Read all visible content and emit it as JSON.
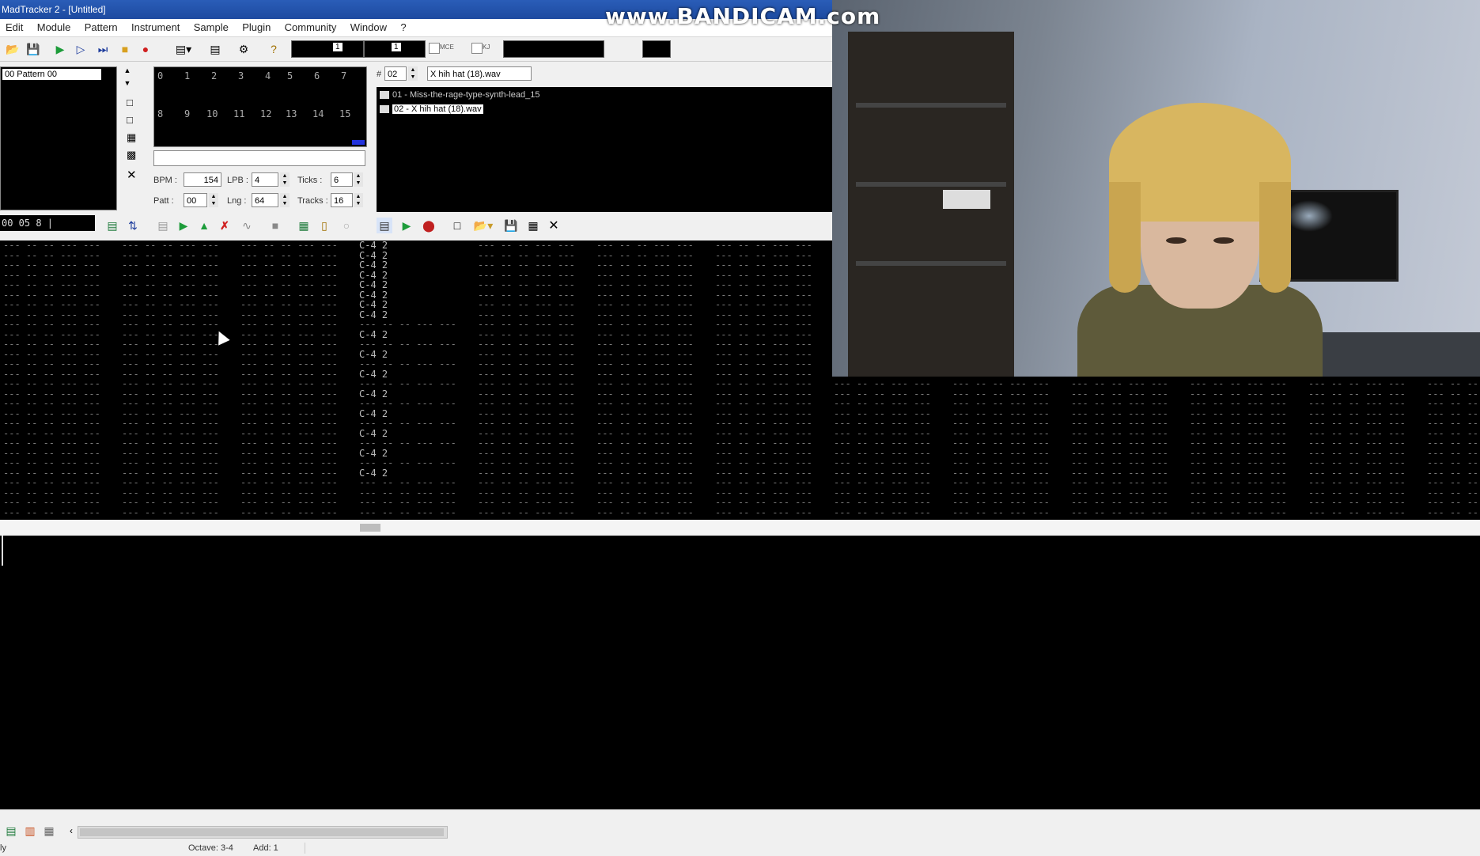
{
  "window": {
    "title": "MadTracker 2 - [Untitled]"
  },
  "watermark": "www.BANDICAM.com",
  "menu": [
    "Edit",
    "Module",
    "Pattern",
    "Instrument",
    "Sample",
    "Plugin",
    "Community",
    "Window",
    "?"
  ],
  "toolbar": {
    "octave_value": "1",
    "step_value": "1",
    "mce_label": "MCE",
    "kj_label": "KJ"
  },
  "pattern_list": {
    "item": "00  Pattern 00"
  },
  "order_grid": {
    "row1": [
      "0",
      "1",
      "2",
      "3",
      "4",
      "5",
      "6",
      "7"
    ],
    "row2": [
      "8",
      "9",
      "10",
      "11",
      "12",
      "13",
      "14",
      "15"
    ]
  },
  "song": {
    "bpm_label": "BPM :",
    "bpm": "154",
    "lpb_label": "LPB :",
    "lpb": "4",
    "ticks_label": "Ticks :",
    "ticks": "6",
    "patt_label": "Patt :",
    "patt": "00",
    "lng_label": "Lng :",
    "lng": "64",
    "tracks_label": "Tracks :",
    "tracks": "16"
  },
  "position_display": "00 05  8 |",
  "sample": {
    "hash": "#",
    "number": "02",
    "name": "X hih hat (18).wav",
    "items": [
      "01 - Miss-the-rage-type-synth-lead_15",
      "02 - X hih hat (18).wav"
    ]
  },
  "pattern": {
    "note": "C-4",
    "instrument": "2",
    "empty_note": "---",
    "empty_cell": "-- -- ---"
  },
  "status": {
    "left": "ly",
    "octave": "Octave: 3-4",
    "add": "Add: 1"
  },
  "colors": {
    "title_bar": "#2a5db8",
    "selected_item": "#ffffff",
    "pattern_text": "#7a7a7a"
  }
}
